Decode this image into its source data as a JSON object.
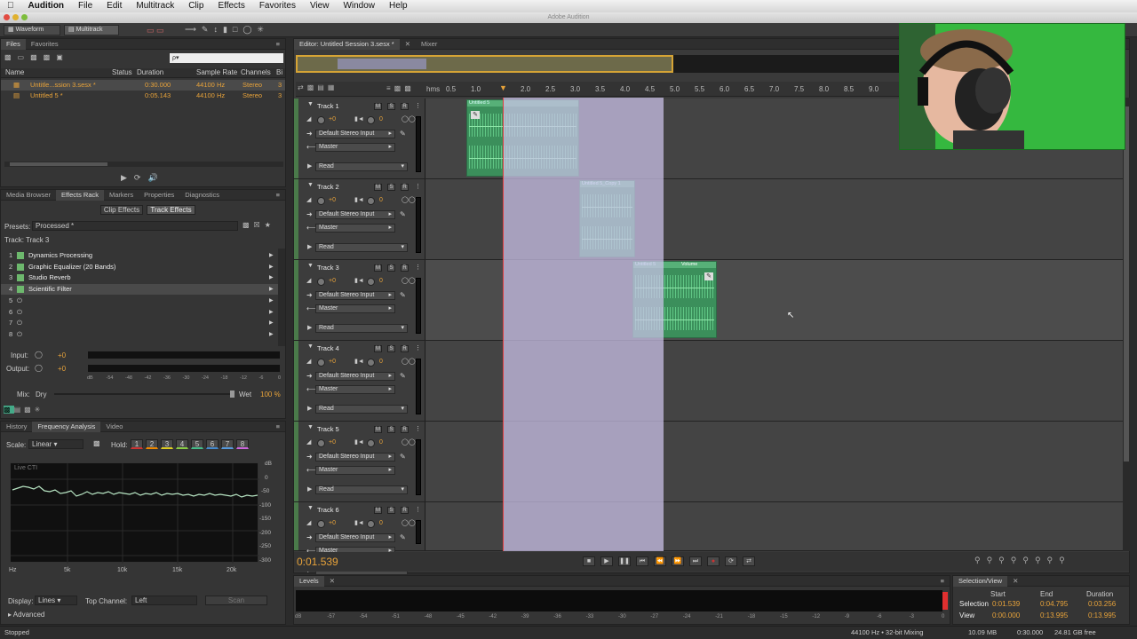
{
  "menubar": {
    "apple": "",
    "app": "Audition",
    "items": [
      "File",
      "Edit",
      "Multitrack",
      "Clip",
      "Effects",
      "Favorites",
      "View",
      "Window",
      "Help"
    ]
  },
  "window": {
    "title": "Adobe Audition"
  },
  "toolbar": {
    "waveform": "Waveform",
    "multitrack": "Multitrack"
  },
  "files": {
    "tabs": [
      "Files",
      "Favorites"
    ],
    "search_placeholder": "ρ▾",
    "columns": [
      "Name",
      "Status",
      "Duration",
      "Sample Rate",
      "Channels",
      "Bi"
    ],
    "rows": [
      {
        "name": "Untitle...ssion 3.sesx *",
        "duration": "0:30.000",
        "rate": "44100 Hz",
        "channels": "Stereo",
        "bits": "3"
      },
      {
        "name": "Untitled 5 *",
        "duration": "0:05.143",
        "rate": "44100 Hz",
        "channels": "Stereo",
        "bits": "3"
      }
    ]
  },
  "effects": {
    "tabs": [
      "Media Browser",
      "Effects Rack",
      "Markers",
      "Properties",
      "Diagnostics"
    ],
    "subtabs": [
      "Clip Effects",
      "Track Effects"
    ],
    "presets_label": "Presets:",
    "presets_value": "Processed *",
    "track_label": "Track: Track 3",
    "slots": [
      {
        "n": "1",
        "name": "Dynamics Processing"
      },
      {
        "n": "2",
        "name": "Graphic Equalizer (20 Bands)"
      },
      {
        "n": "3",
        "name": "Studio Reverb"
      },
      {
        "n": "4",
        "name": "Scientific Filter"
      },
      {
        "n": "5",
        "name": ""
      },
      {
        "n": "6",
        "name": ""
      },
      {
        "n": "7",
        "name": ""
      },
      {
        "n": "8",
        "name": ""
      }
    ],
    "input_label": "Input:",
    "output_label": "Output:",
    "gain": "+0",
    "mix_label": "Mix:",
    "dry": "Dry",
    "wet": "Wet",
    "wet_pct": "100 %",
    "scale": [
      "dB",
      "-54",
      "-48",
      "-42",
      "-36",
      "-30",
      "-24",
      "-18",
      "-12",
      "-6",
      "0"
    ]
  },
  "freq": {
    "tabs": [
      "History",
      "Frequency Analysis",
      "Video"
    ],
    "scale_label": "Scale:",
    "scale_value": "Linear",
    "hold_label": "Hold:",
    "hold": [
      "1",
      "2",
      "3",
      "4",
      "5",
      "6",
      "7",
      "8"
    ],
    "graph_label": "Live CTI",
    "db": [
      "dB",
      "0",
      "-50",
      "-100",
      "-150",
      "-200",
      "-250",
      "-300"
    ],
    "hz": [
      "Hz",
      "5k",
      "10k",
      "15k",
      "20k"
    ],
    "display_label": "Display:",
    "display_value": "Lines",
    "top_label": "Top Channel:",
    "top_value": "Left",
    "scan": "Scan",
    "advanced": "Advanced"
  },
  "editor": {
    "tab": "Editor: Untitled Session 3.sesx *",
    "mixer": "Mixer",
    "ruler_unit": "hms",
    "ruler": [
      "0.5",
      "1.0",
      "2.0",
      "2.5",
      "3.0",
      "3.5",
      "4.0",
      "4.5",
      "5.0",
      "5.5",
      "6.0",
      "6.5",
      "7.0",
      "7.5",
      "8.0",
      "8.5",
      "9.0"
    ],
    "tracks": [
      {
        "name": "Track 1"
      },
      {
        "name": "Track 2"
      },
      {
        "name": "Track 3"
      },
      {
        "name": "Track 4"
      },
      {
        "name": "Track 5"
      },
      {
        "name": "Track 6"
      }
    ],
    "track_vol": "+0",
    "track_pan": "0",
    "input": "Default Stereo Input",
    "output": "Master",
    "mode": "Read",
    "clips": {
      "c1": "Untitled 5",
      "c2": "Untitled 5_Copy 1",
      "c3": "Untitled 5",
      "c3b": "Volume"
    },
    "time": "0:01.539"
  },
  "levels": {
    "tab": "Levels",
    "ticks": [
      "dB",
      "-57",
      "-54",
      "-51",
      "-48",
      "-45",
      "-42",
      "-39",
      "-36",
      "-33",
      "-30",
      "-27",
      "-24",
      "-21",
      "-18",
      "-15",
      "-12",
      "-9",
      "-6",
      "-3",
      "0"
    ]
  },
  "selview": {
    "tab": "Selection/View",
    "cols": [
      "Start",
      "End",
      "Duration"
    ],
    "selection_label": "Selection",
    "view_label": "View",
    "selection": [
      "0:01.539",
      "0:04.795",
      "0:03.256"
    ],
    "view": [
      "0:00.000",
      "0:13.995",
      "0:13.995"
    ]
  },
  "status": {
    "left": "Stopped",
    "rate": "44100 Hz • 32-bit Mixing",
    "mem": "10.09 MB",
    "dur": "0:30.000",
    "free": "24.81 GB free"
  }
}
